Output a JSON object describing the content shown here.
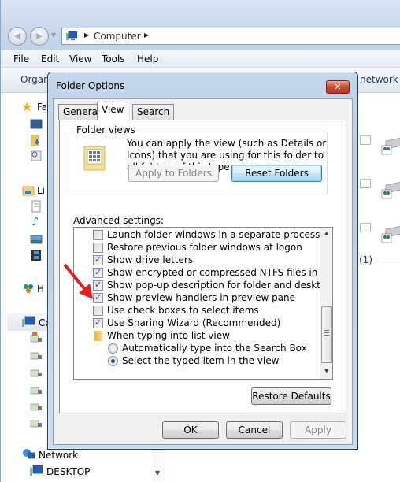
{
  "explorer": {
    "address": {
      "crumbs": [
        "Computer"
      ]
    },
    "menu": [
      "File",
      "Edit",
      "View",
      "Tools",
      "Help"
    ],
    "command_bar": {
      "organize": "Organ",
      "right_link": "network c"
    },
    "nav_pane": {
      "favorites_label": "Fa",
      "libraries_label": "Li",
      "homegroup_label": "H",
      "computer_label": "Co",
      "network_label": "Network",
      "desktop_label": "DESKTOP"
    },
    "content": {
      "group_count": "(1)"
    }
  },
  "dialog": {
    "title": "Folder Options",
    "close_glyph": "✕",
    "tabs": [
      {
        "label": "General",
        "active": false
      },
      {
        "label": "View",
        "active": true
      },
      {
        "label": "Search",
        "active": false
      }
    ],
    "folder_views": {
      "label": "Folder views",
      "description": "You can apply the view (such as Details or Icons) that you are using for this folder to all folders of this type.",
      "apply_button": "Apply to Folders",
      "reset_button": "Reset Folders"
    },
    "advanced": {
      "label": "Advanced settings:",
      "items": [
        {
          "type": "checkbox",
          "label": "Launch folder windows in a separate process",
          "checked": false
        },
        {
          "type": "checkbox",
          "label": "Restore previous folder windows at logon",
          "checked": false
        },
        {
          "type": "checkbox",
          "label": "Show drive letters",
          "checked": true
        },
        {
          "type": "checkbox",
          "label": "Show encrypted or compressed NTFS files in color",
          "checked": true
        },
        {
          "type": "checkbox",
          "label": "Show pop-up description for folder and desktop items",
          "checked": true
        },
        {
          "type": "checkbox",
          "label": "Show preview handlers in preview pane",
          "checked": true
        },
        {
          "type": "checkbox",
          "label": "Use check boxes to select items",
          "checked": false
        },
        {
          "type": "checkbox",
          "label": "Use Sharing Wizard (Recommended)",
          "checked": true
        },
        {
          "type": "folder",
          "label": "When typing into list view"
        },
        {
          "type": "radio",
          "label": "Automatically type into the Search Box",
          "checked": false
        },
        {
          "type": "radio",
          "label": "Select the typed item in the view",
          "checked": true
        }
      ]
    },
    "restore_defaults": "Restore Defaults",
    "ok": "OK",
    "cancel": "Cancel",
    "apply": "Apply"
  },
  "annotation": {
    "arrow_color": "#e02020"
  }
}
